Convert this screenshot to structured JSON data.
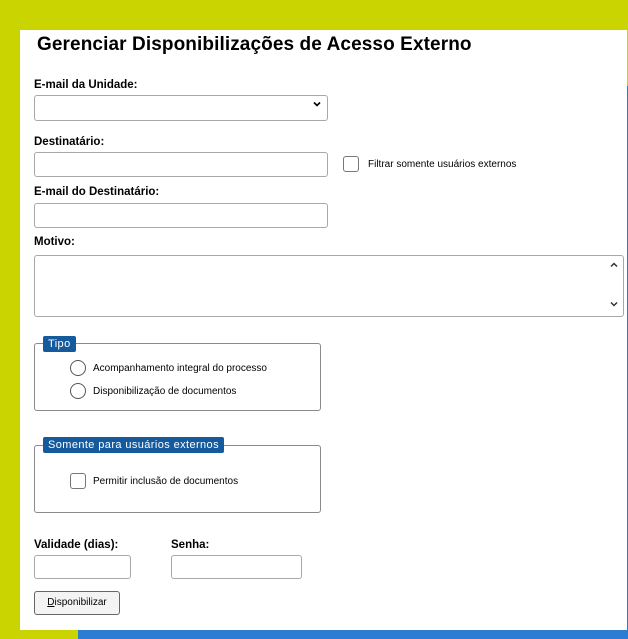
{
  "form": {
    "title": "Gerenciar Disponibilizações de Acesso Externo",
    "email_unidade_label": "E-mail da Unidade:",
    "email_unidade_value": "",
    "destinatario_label": "Destinatário:",
    "destinatario_value": "",
    "filtrar_label": "Filtrar somente usuários externos",
    "email_dest_label": "E-mail do Destinatário:",
    "email_dest_value": "",
    "motivo_label": "Motivo:",
    "motivo_value": "",
    "tipo": {
      "legend": "Tipo",
      "options": [
        "Acompanhamento integral do processo",
        "Disponibilização de documentos"
      ]
    },
    "externos": {
      "legend": "Somente para usuários externos",
      "permitir_label": "Permitir inclusão de documentos"
    },
    "validade_label": "Validade (dias):",
    "validade_value": "",
    "senha_label": "Senha:",
    "senha_value": "",
    "submit_first_letter": "D",
    "submit_rest": "isponibilizar"
  },
  "icons": {
    "select_chevron": "chevron-down-icon",
    "scroll_up": "chevron-up-icon",
    "scroll_down": "chevron-down-icon"
  },
  "colors": {
    "background_yellow": "#c9d400",
    "frame_blue": "#2b7cd3",
    "legend_blue": "#155a9c"
  }
}
